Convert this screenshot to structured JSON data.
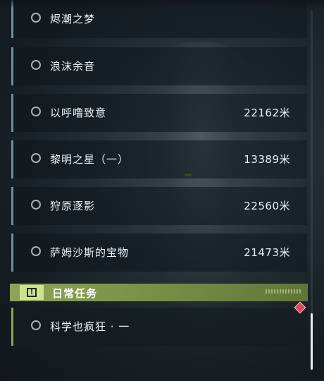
{
  "quests": [
    {
      "name": "烬潮之梦",
      "distance": ""
    },
    {
      "name": "浪沫余音",
      "distance": ""
    },
    {
      "name": "以呼噜致意",
      "distance": "22162米"
    },
    {
      "name": "黎明之星（一）",
      "distance": "13389米"
    },
    {
      "name": "狩原逐影",
      "distance": "22560米"
    },
    {
      "name": "萨姆沙斯的宝物",
      "distance": "21473米"
    }
  ],
  "daily_section": {
    "title": "日常任务",
    "icon": "exclamation-icon",
    "accent_color": "#8fa45a"
  },
  "daily_quests": [
    {
      "name": "科学也疯狂 · 一",
      "distance": ""
    }
  ],
  "colors": {
    "quest_border": "#6f8ea0",
    "marker": "#d84a5a"
  }
}
